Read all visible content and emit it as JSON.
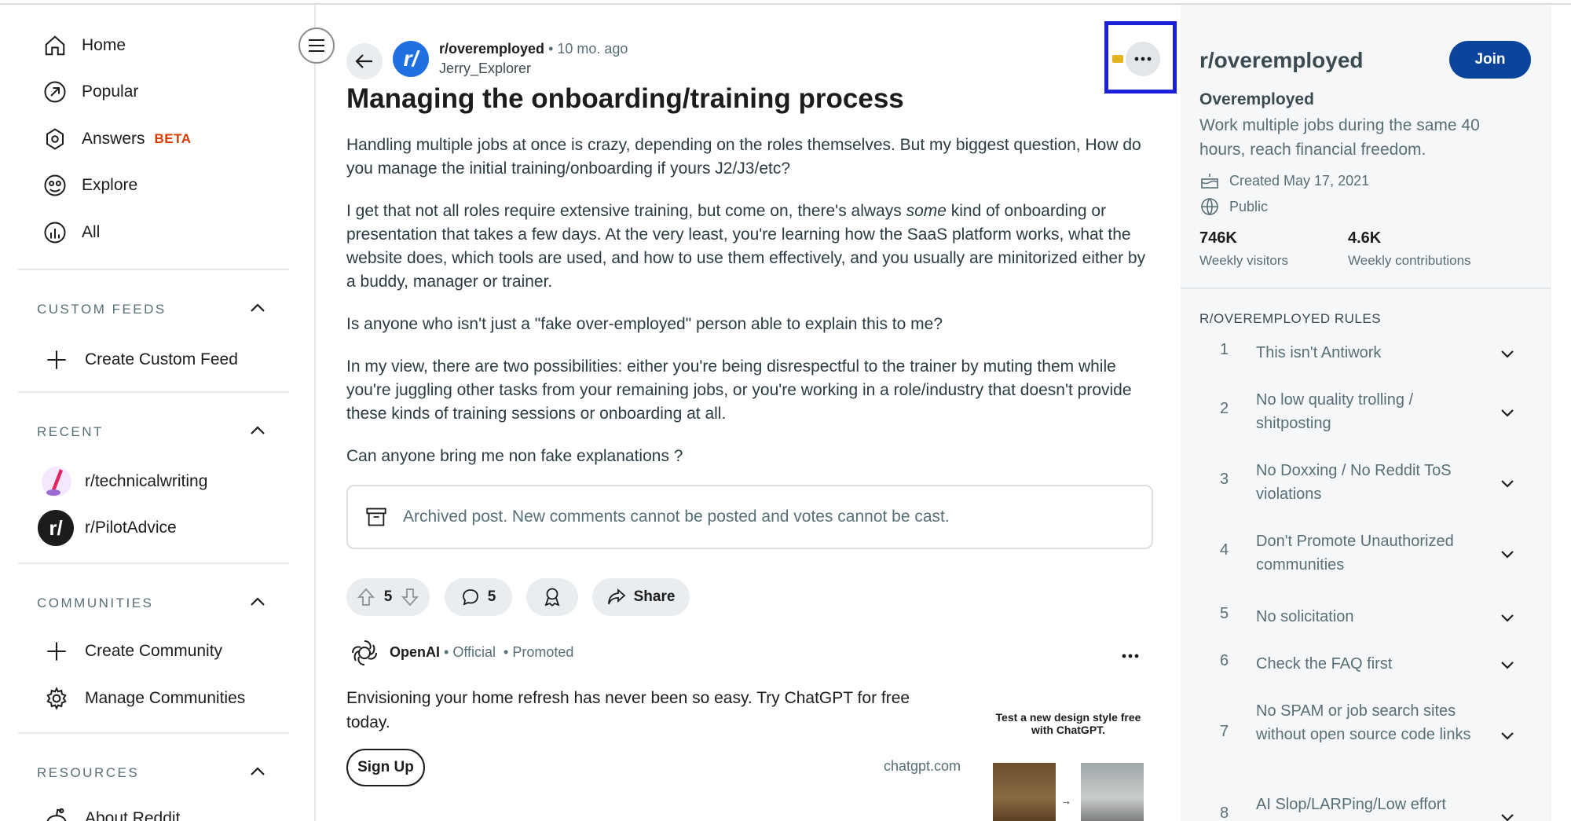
{
  "nav": {
    "items": [
      {
        "label": "Home",
        "icon": "home-icon"
      },
      {
        "label": "Popular",
        "icon": "popular-icon"
      },
      {
        "label": "Answers",
        "icon": "answers-icon",
        "badge": "BETA"
      },
      {
        "label": "Explore",
        "icon": "explore-icon"
      },
      {
        "label": "All",
        "icon": "all-icon"
      }
    ]
  },
  "custom_feeds": {
    "heading": "CUSTOM FEEDS",
    "create_label": "Create Custom Feed"
  },
  "recent": {
    "heading": "RECENT",
    "items": [
      {
        "label": "r/technicalwriting"
      },
      {
        "label": "r/PilotAdvice"
      }
    ]
  },
  "communities": {
    "heading": "COMMUNITIES",
    "create_label": "Create Community",
    "manage_label": "Manage Communities"
  },
  "resources": {
    "heading": "RESOURCES",
    "about_label": "About Reddit"
  },
  "post": {
    "subreddit": "r/overemployed",
    "age": "• 10 mo. ago",
    "author": "Jerry_Explorer",
    "title": "Managing the onboarding/training process",
    "body": {
      "p1": "Handling multiple jobs at once is crazy, depending on the roles themselves. But my biggest question, How do you manage the initial training/onboarding if yours J2/J3/etc?",
      "p2_before": "I get that not all roles require extensive training, but come on, there's always ",
      "p2_em": "some",
      "p2_after": " kind of onboarding or presentation that takes a few days. At the very least, you're learning how the SaaS platform works, what the website does, which tools are used, and how to use them effectively, and you usually are minitorized either by a buddy, manager or trainer.",
      "p3": "Is anyone who isn't just a \"fake over-employed\" person able to explain this to me?",
      "p4": "In my view, there are two possibilities: either you're being disrespectful to the trainer by muting them while you're juggling other tasks from your remaining jobs, or you're working in a role/industry that doesn't provide these kinds of training sessions or onboarding at all.",
      "p5": "Can anyone bring me non fake explanations ?"
    },
    "archived_notice": "Archived post. New comments cannot be posted and votes cannot be cast.",
    "votes": "5",
    "comments": "5",
    "share_label": "Share"
  },
  "promo": {
    "brand": "OpenAI",
    "official": "• Official",
    "promoted": "• Promoted",
    "text": "Envisioning your home refresh has never been so easy. Try ChatGPT for free today.",
    "cta": "Sign Up",
    "domain": "chatgpt.com",
    "image_caption": "Test a new design style free with ChatGPT."
  },
  "community": {
    "name": "r/overemployed",
    "join_label": "Join",
    "title": "Overemployed",
    "description": "Work multiple jobs during the same 40 hours, reach financial freedom.",
    "created": "Created May 17, 2021",
    "visibility": "Public",
    "stats": [
      {
        "value": "746K",
        "label": "Weekly visitors"
      },
      {
        "value": "4.6K",
        "label": "Weekly contributions"
      }
    ],
    "rules_heading": "R/OVEREMPLOYED RULES",
    "rules": [
      {
        "num": "1",
        "text": "This isn't Antiwork"
      },
      {
        "num": "2",
        "text": "No low quality trolling / shitposting"
      },
      {
        "num": "3",
        "text": "No Doxxing / No Reddit ToS violations"
      },
      {
        "num": "4",
        "text": "Don't Promote Unauthorized communities"
      },
      {
        "num": "5",
        "text": "No solicitation"
      },
      {
        "num": "6",
        "text": "Check the FAQ first"
      },
      {
        "num": "7",
        "text": "No SPAM or job search sites without open source code links"
      },
      {
        "num": "8",
        "text": "AI Slop/LARPing/Low effort posts"
      }
    ]
  },
  "colors": {
    "join": "#0a449b",
    "beta": "#d93a00",
    "highlight": "#1b1fd6",
    "subreddit_avatar": "#1f6fe0"
  }
}
